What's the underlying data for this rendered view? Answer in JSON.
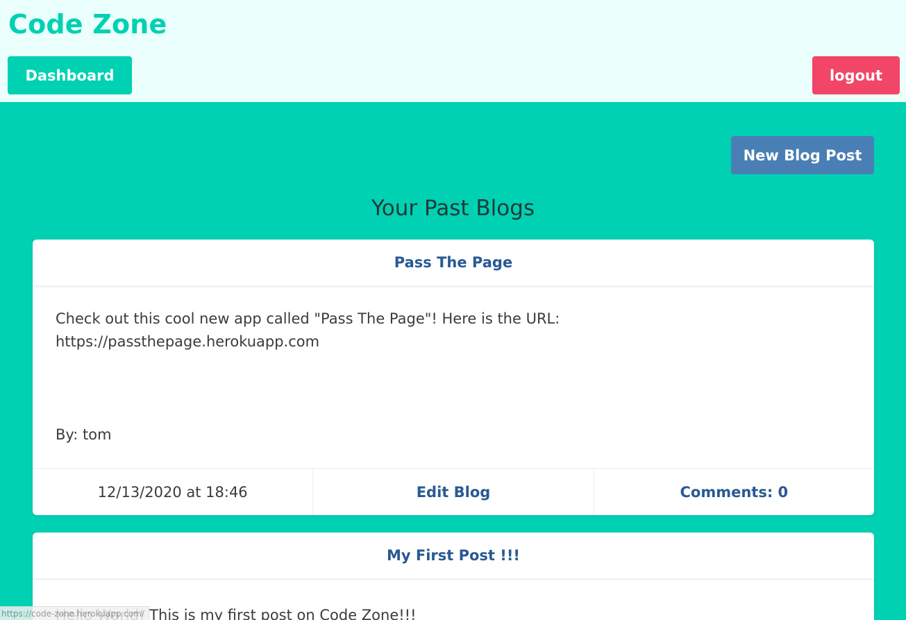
{
  "header": {
    "brand": "Code Zone",
    "dashboard_label": "Dashboard",
    "logout_label": "logout"
  },
  "main": {
    "new_post_label": "New Blog Post",
    "section_title": "Your Past Blogs",
    "posts": [
      {
        "title": "Pass The Page",
        "body": "Check out this cool new app called \"Pass The Page\"! Here is the URL: https://passthepage.herokuapp.com",
        "author": "By: tom",
        "date": "12/13/2020 at 18:46",
        "edit_label": "Edit Blog",
        "comments_label": "Comments: 0"
      },
      {
        "title": "My First Post !!!",
        "body": "Hello World! This is my first post on Code Zone!!!"
      }
    ]
  },
  "status_bar": {
    "url": "https://code-zone.herokuapp.com/"
  },
  "colors": {
    "brand": "#00d1b2",
    "header_bg": "#ebfffc",
    "logout": "#f14668",
    "new_post": "#4a7fb5",
    "link": "#295994"
  }
}
